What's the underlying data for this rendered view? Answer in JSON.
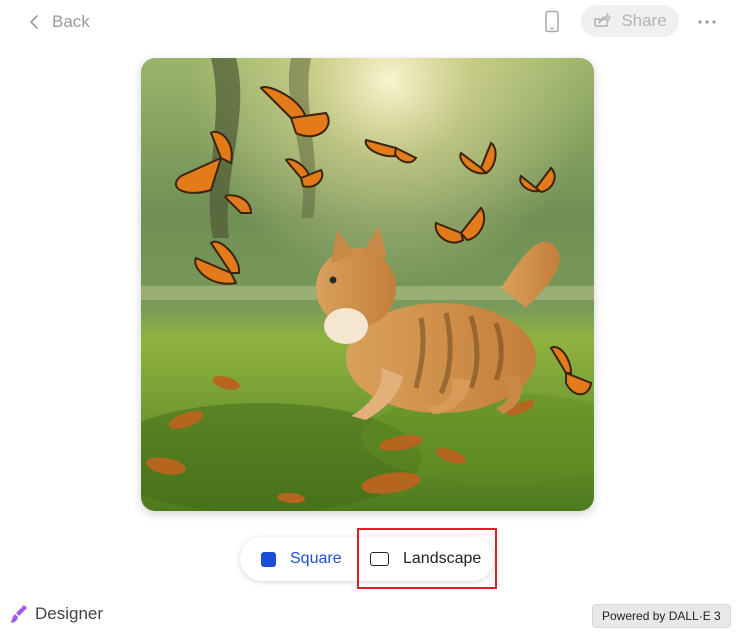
{
  "header": {
    "back_label": "Back",
    "share_label": "Share"
  },
  "image": {
    "subject": "orange tabby cat walking on grass among monarch butterflies"
  },
  "aspect": {
    "options": [
      {
        "label": "Square",
        "icon": "square-filled-icon",
        "selected": true
      },
      {
        "label": "Landscape",
        "icon": "landscape-outline-icon",
        "selected": false
      }
    ],
    "accent_color": "#1d4ed8",
    "highlight_color": "#e11d27"
  },
  "footer": {
    "brand_label": "Designer",
    "powered_label": "Powered by DALL·E 3"
  }
}
